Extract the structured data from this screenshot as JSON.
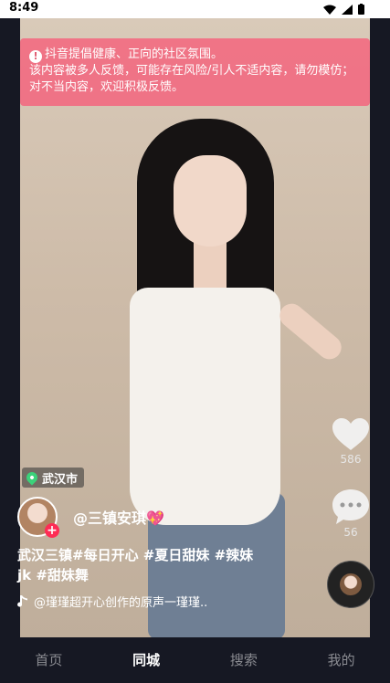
{
  "status_bar": {
    "time": "8:49"
  },
  "warning": {
    "line1": "抖音提倡健康、正向的社区氛围。",
    "line2": "该内容被多人反馈，可能存在风险/引人不适内容，请勿模仿；对不当内容，欢迎积极反馈。"
  },
  "video": {
    "location": "武汉市",
    "author": "@三镇安琪💖",
    "caption": "武汉三镇#每日开心 #夏日甜妹 #辣妹jk #甜妹舞",
    "music": "@瑾瑾超开心创作的原声一瑾瑾.."
  },
  "actions": {
    "likes": "586",
    "comments": "56"
  },
  "tabs": [
    {
      "label": "首页"
    },
    {
      "label": "同城"
    },
    {
      "label": "搜索"
    },
    {
      "label": "我的"
    }
  ],
  "colors": {
    "accent": "#fe2c55",
    "warning_bg": "#f26880",
    "location_pin": "#3bd27a"
  }
}
